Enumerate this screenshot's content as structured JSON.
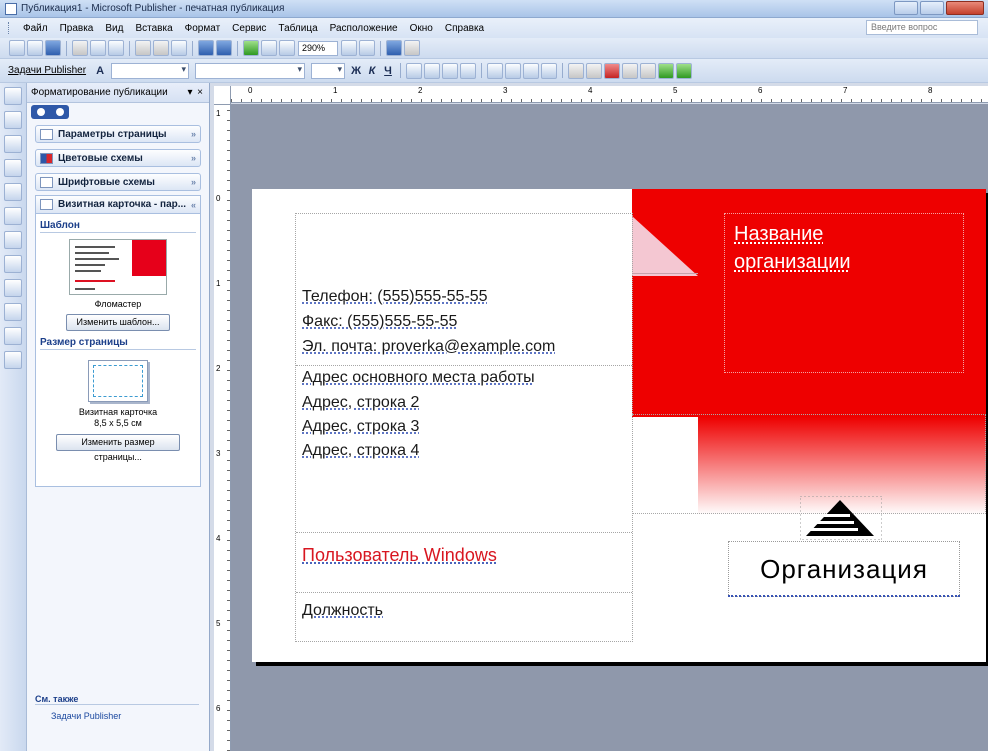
{
  "window": {
    "title": "Публикация1 - Microsoft Publisher - печатная публикация"
  },
  "menu": {
    "items": [
      "Файл",
      "Правка",
      "Вид",
      "Вставка",
      "Формат",
      "Сервис",
      "Таблица",
      "Расположение",
      "Окно",
      "Справка"
    ],
    "help_placeholder": "Введите вопрос"
  },
  "toolbar": {
    "zoom": "290%",
    "tasks_label": "Задачи Publisher",
    "icons": [
      "new-icon",
      "open-icon",
      "save-icon",
      "print-icon",
      "preview-icon",
      "spell-icon",
      "cut-icon",
      "copy-icon",
      "paste-icon",
      "undo-icon",
      "redo-icon",
      "zoom-in-icon",
      "zoom-out-icon",
      "help-icon"
    ]
  },
  "taskpane": {
    "title": "Форматирование публикации",
    "sections": [
      {
        "label": "Параметры страницы",
        "icon": "page-setup-icon"
      },
      {
        "label": "Цветовые схемы",
        "icon": "color-scheme-icon"
      },
      {
        "label": "Шрифтовые схемы",
        "icon": "font-scheme-icon"
      }
    ],
    "active_section": "Визитная карточка - пар...",
    "template_label": "Шаблон",
    "template_name": "Фломастер",
    "change_template_button": "Изменить шаблон...",
    "page_size_label": "Размер страницы",
    "page_size_name": "Визитная карточка",
    "page_size_dims": "8,5 х 5,5 см",
    "change_size_button": "Изменить размер страницы...",
    "see_also_label": "См. также",
    "see_also_link": "Задачи Publisher"
  },
  "rulers": {
    "horizontal_numbers": [
      "0",
      "1",
      "2",
      "3",
      "4",
      "5",
      "6",
      "7",
      "8"
    ],
    "vertical_numbers": [
      "1",
      "0",
      "1",
      "2",
      "3",
      "4",
      "5",
      "6"
    ]
  },
  "card": {
    "phone": "Телефон: (555)555-55-55",
    "fax": "Факс: (555)555-55-55",
    "email": "Эл. почта: proverka@example.com",
    "address1": "Адрес основного места работы",
    "address2": "Адрес, строка 2",
    "address3": "Адрес, строка 3",
    "address4": "Адрес, строка 4",
    "user_name": "Пользователь Windows",
    "position": "Должность",
    "org_title_line1": "Название",
    "org_title_line2": "организации",
    "org_logo_text": "Организация",
    "colors": {
      "accent": "#ee0000",
      "fold": "#f4c7d2",
      "name": "#d81620"
    }
  }
}
